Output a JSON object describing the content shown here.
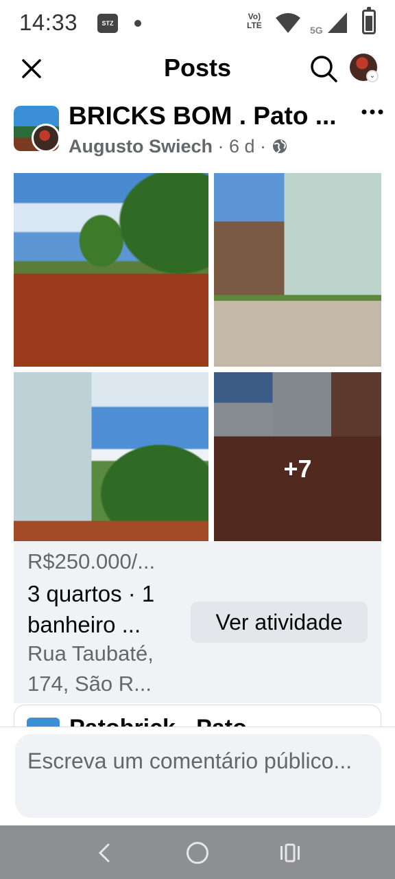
{
  "status_bar": {
    "time": "14:33",
    "stz_label": "STZ",
    "volte_label": "Vo)\nLTE",
    "network_label": "5G"
  },
  "header": {
    "title": "Posts"
  },
  "post": {
    "group_name": "BRICKS BOM . Pato ...",
    "author": "Augusto Swiech",
    "meta": "· 6 d ·",
    "more_photos_label": "+7"
  },
  "listing": {
    "price": "R$250.000/...",
    "details": "3 quartos · 1 banheiro ...",
    "address": "Rua Taubaté, 174, São R...",
    "activity_button": "Ver atividade"
  },
  "next_post": {
    "title": "Patobrick - Pato"
  },
  "comment": {
    "placeholder": "Escreva um comentário público..."
  }
}
